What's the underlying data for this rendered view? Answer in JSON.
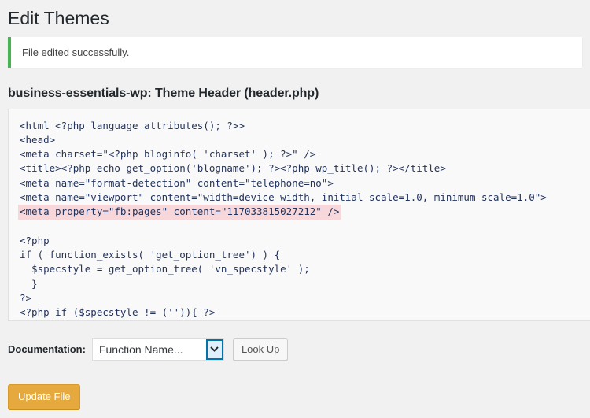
{
  "page": {
    "title": "Edit Themes"
  },
  "notice": {
    "message": "File edited successfully.",
    "accent_color": "#46b450"
  },
  "file_heading": "business-essentials-wp: Theme Header (header.php)",
  "editor": {
    "highlight_color": "#f8d7da",
    "text_color": "#22335c",
    "lines": [
      {
        "text": "<html <?php language_attributes(); ?>>",
        "highlighted": false
      },
      {
        "text": "<head>",
        "highlighted": false
      },
      {
        "text": "<meta charset=\"<?php bloginfo( 'charset' ); ?>\" />",
        "highlighted": false
      },
      {
        "text": "<title><?php echo get_option('blogname'); ?><?php wp_title(); ?></title>",
        "highlighted": false
      },
      {
        "text": "<meta name=\"format-detection\" content=\"telephone=no\">",
        "highlighted": false
      },
      {
        "text": "<meta name=\"viewport\" content=\"width=device-width, initial-scale=1.0, minimum-scale=1.0\">",
        "highlighted": false
      },
      {
        "text": "<meta property=\"fb:pages\" content=\"117033815027212\" />",
        "highlighted": true
      },
      {
        "text": "",
        "highlighted": false
      },
      {
        "text": "<?php",
        "highlighted": false
      },
      {
        "text": "if ( function_exists( 'get_option_tree') ) {",
        "highlighted": false
      },
      {
        "text": "  $specstyle = get_option_tree( 'vn_specstyle' );",
        "highlighted": false
      },
      {
        "text": "  }",
        "highlighted": false
      },
      {
        "text": "?>",
        "highlighted": false
      },
      {
        "text": "<?php if ($specstyle != ('')){ ?>",
        "highlighted": false
      }
    ]
  },
  "documentation": {
    "label": "Documentation:",
    "selected_option": "Function Name...",
    "options": [
      "Function Name..."
    ],
    "lookup_label": "Look Up"
  },
  "submit": {
    "update_label": "Update File",
    "button_color": "#e5a93d"
  }
}
